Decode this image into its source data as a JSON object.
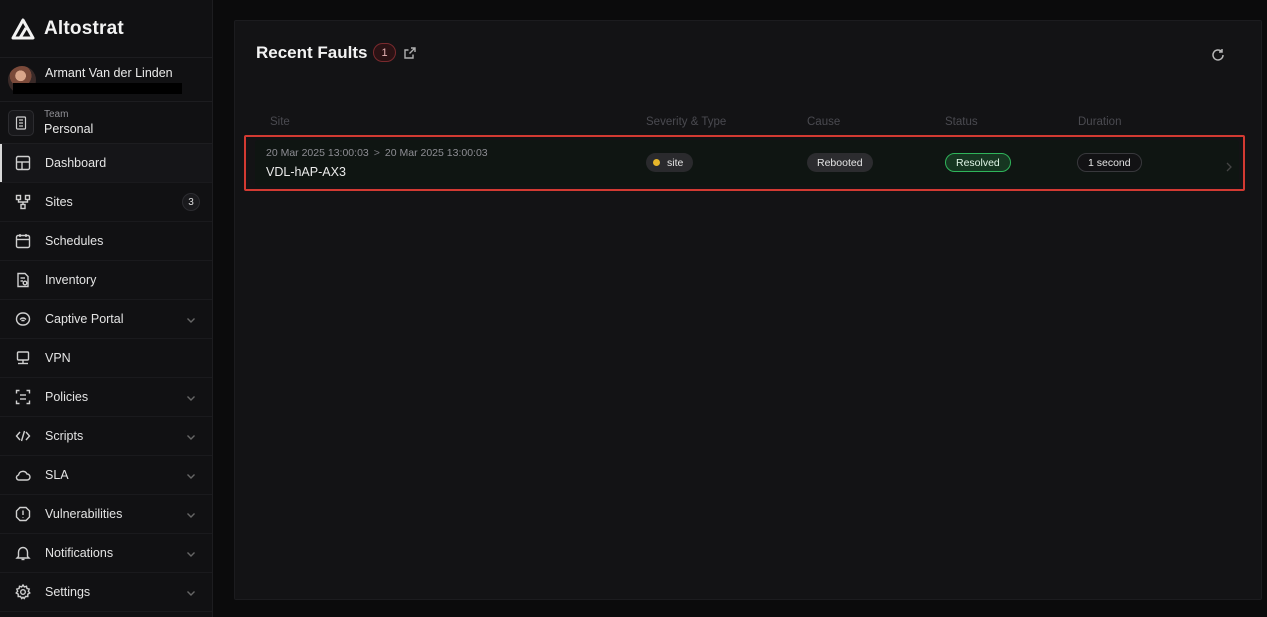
{
  "brand": {
    "name": "Altostrat"
  },
  "user": {
    "name": "Armant Van der Linden"
  },
  "team": {
    "label": "Team",
    "value": "Personal"
  },
  "nav": [
    {
      "label": "Dashboard",
      "icon": "dashboard-icon",
      "active": true
    },
    {
      "label": "Sites",
      "icon": "sites-icon",
      "badge": "3"
    },
    {
      "label": "Schedules",
      "icon": "calendar-icon"
    },
    {
      "label": "Inventory",
      "icon": "inventory-icon"
    },
    {
      "label": "Captive Portal",
      "icon": "captive-portal-icon",
      "expandable": true
    },
    {
      "label": "VPN",
      "icon": "vpn-icon"
    },
    {
      "label": "Policies",
      "icon": "policies-icon",
      "expandable": true
    },
    {
      "label": "Scripts",
      "icon": "code-icon",
      "expandable": true
    },
    {
      "label": "SLA",
      "icon": "cloud-icon",
      "expandable": true
    },
    {
      "label": "Vulnerabilities",
      "icon": "alert-icon",
      "expandable": true
    },
    {
      "label": "Notifications",
      "icon": "bell-icon",
      "expandable": true
    },
    {
      "label": "Settings",
      "icon": "gear-icon",
      "expandable": true
    }
  ],
  "faults": {
    "title": "Recent Faults",
    "count": "1",
    "columns": [
      "Site",
      "Severity & Type",
      "Cause",
      "Status",
      "Duration"
    ],
    "rows": [
      {
        "start": "20 Mar 2025 13:00:03",
        "arrow": ">",
        "end": "20 Mar 2025 13:00:03",
        "site": "VDL-hAP-AX3",
        "type": "site",
        "cause": "Rebooted",
        "status": "Resolved",
        "duration": "1 second"
      }
    ]
  },
  "colors": {
    "severity_dot": "#e7b62a",
    "status_resolved": "#2fb45a",
    "highlight_border": "#d33a32"
  }
}
